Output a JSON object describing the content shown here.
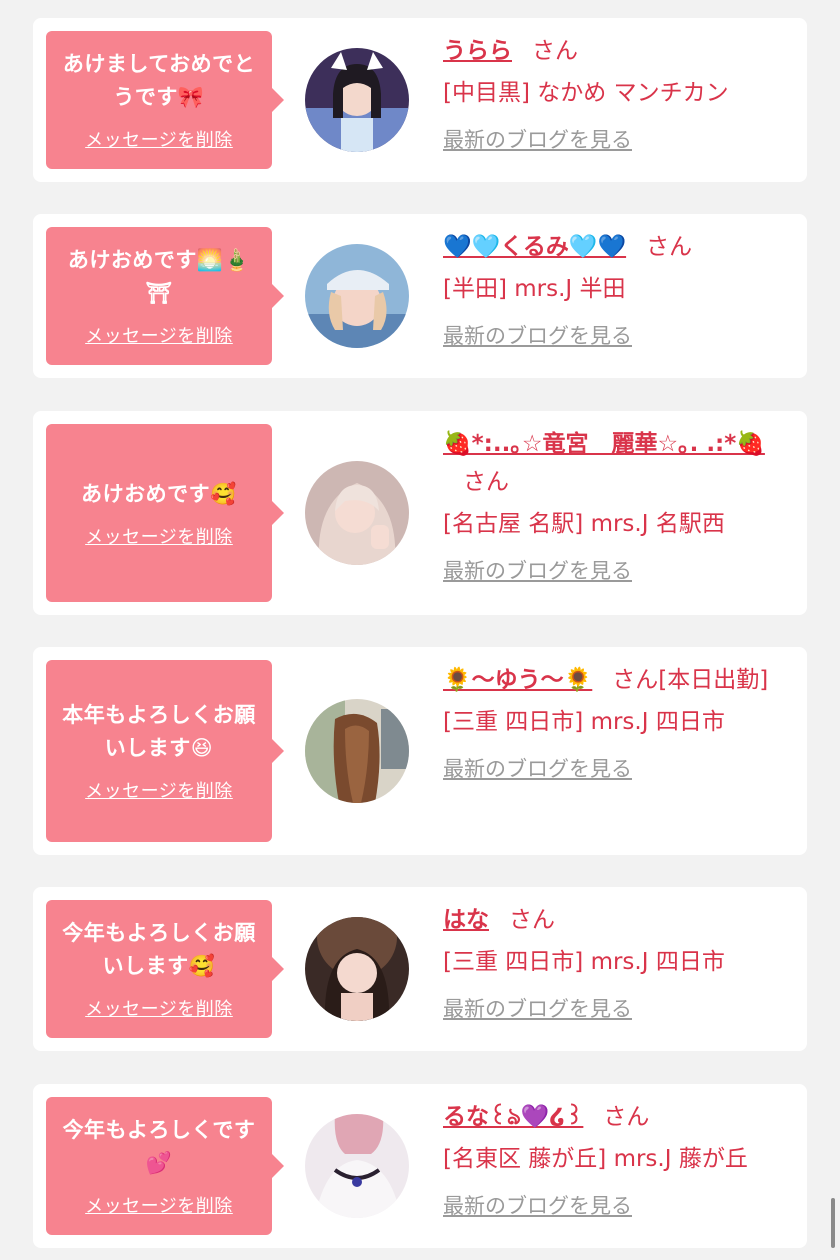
{
  "messages": [
    {
      "message": "あけましておめでとうです🎀",
      "delete_label": "メッセージを削除",
      "name": "うらら",
      "honorific": "さん",
      "shop": "[中目黒] なかめ マンチカン",
      "blog_link": "最新のブログを見る"
    },
    {
      "message": "あけおめです🌅🎍⛩",
      "delete_label": "メッセージを削除",
      "name": "💙🩵くるみ🩵💙",
      "honorific": "さん",
      "shop": "[半田] mrs.J 半田",
      "blog_link": "最新のブログを見る"
    },
    {
      "message": "あけおめです🥰",
      "delete_label": "メッセージを削除",
      "name": "🍓*:..｡☆竜宮　麗華☆｡. .:*🍓",
      "honorific": "さん",
      "shop": "[名古屋 名駅] mrs.J 名駅西",
      "blog_link": "最新のブログを見る"
    },
    {
      "message": "本年もよろしくお願いします😆",
      "delete_label": "メッセージを削除",
      "name": "🌻〜ゆう〜🌻",
      "honorific": "さん[本日出勤]",
      "shop": "[三重 四日市] mrs.J 四日市",
      "blog_link": "最新のブログを見る"
    },
    {
      "message": "今年もよろしくお願いします🥰",
      "delete_label": "メッセージを削除",
      "name": "はな",
      "honorific": "さん",
      "shop": "[三重 四日市] mrs.J 四日市",
      "blog_link": "最新のブログを見る"
    },
    {
      "message": "今年もよろしくです💕",
      "delete_label": "メッセージを削除",
      "name": "るな꒰ঌ💜໒꒱",
      "honorific": "さん",
      "shop": "[名東区 藤が丘] mrs.J 藤が丘",
      "blog_link": "最新のブログを見る"
    }
  ],
  "colors": {
    "page_background": "#f2f2f2",
    "card_background": "#ffffff",
    "bubble": "#f7838f",
    "accent_text": "#d9344a",
    "link_gray": "#9a9a9a"
  }
}
